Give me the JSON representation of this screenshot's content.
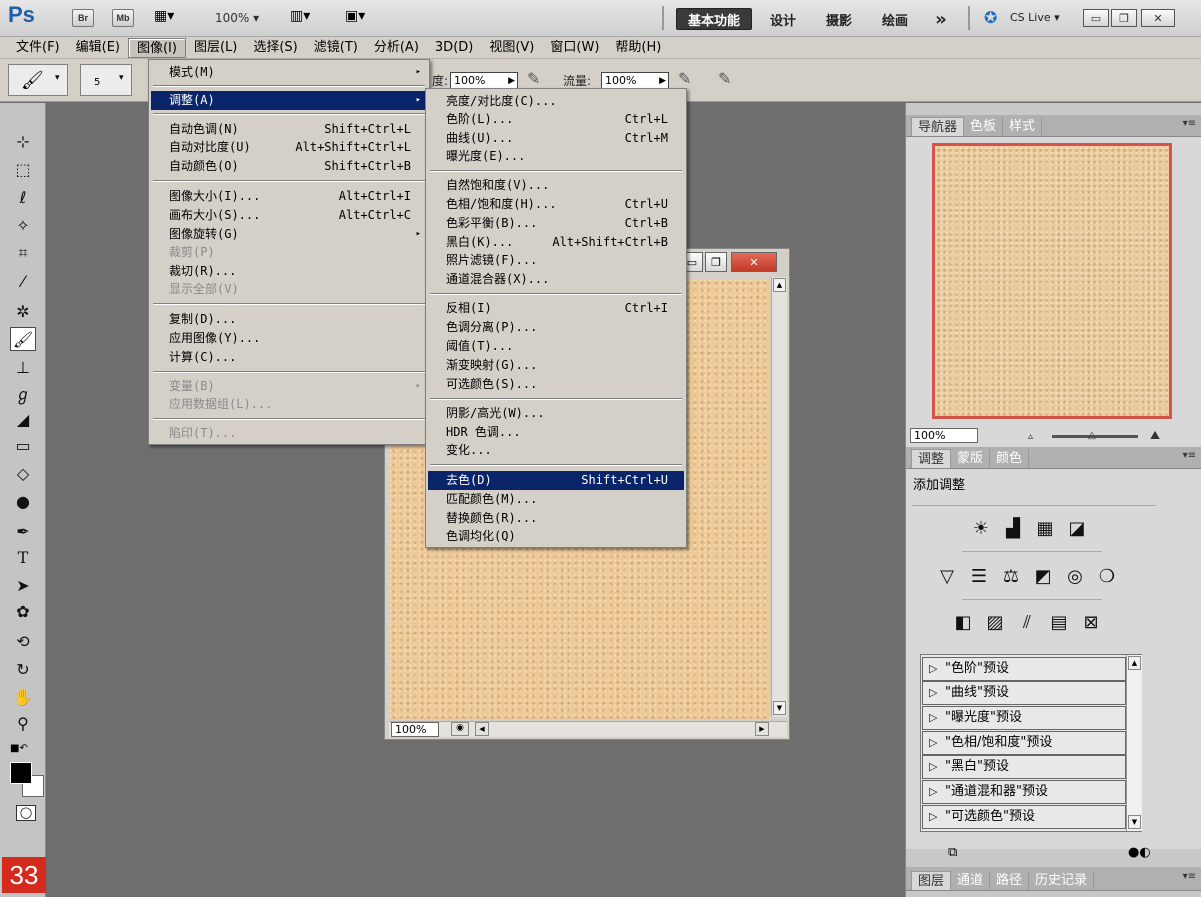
{
  "appbar": {
    "logo": "Ps",
    "br": "Br",
    "mb": "Mb",
    "zoom": "100%",
    "workspaces": [
      "基本功能",
      "设计",
      "摄影",
      "绘画"
    ],
    "more": "»",
    "cslive": "CS Live"
  },
  "menubar": [
    "文件(F)",
    "编辑(E)",
    "图像(I)",
    "图层(L)",
    "选择(S)",
    "滤镜(T)",
    "分析(A)",
    "3D(D)",
    "视图(V)",
    "窗口(W)",
    "帮助(H)"
  ],
  "options": {
    "brush_size": "5",
    "opacity_label": "度:",
    "opacity": "100%",
    "flow_label": "流量:",
    "flow": "100%"
  },
  "image_menu": {
    "items": [
      {
        "label": "模式(M)",
        "arrow": "▸"
      },
      {
        "label": "调整(A)",
        "arrow": "▸"
      },
      {
        "label": "自动色调(N)",
        "shortcut": "Shift+Ctrl+L"
      },
      {
        "label": "自动对比度(U)",
        "shortcut": "Alt+Shift+Ctrl+L"
      },
      {
        "label": "自动颜色(O)",
        "shortcut": "Shift+Ctrl+B"
      },
      {
        "label": "图像大小(I)...",
        "shortcut": "Alt+Ctrl+I"
      },
      {
        "label": "画布大小(S)...",
        "shortcut": "Alt+Ctrl+C"
      },
      {
        "label": "图像旋转(G)",
        "arrow": "▸"
      },
      {
        "label": "裁剪(P)"
      },
      {
        "label": "裁切(R)..."
      },
      {
        "label": "显示全部(V)"
      },
      {
        "label": "复制(D)..."
      },
      {
        "label": "应用图像(Y)..."
      },
      {
        "label": "计算(C)..."
      },
      {
        "label": "变量(B)",
        "arrow": "▸"
      },
      {
        "label": "应用数据组(L)..."
      },
      {
        "label": "陷印(T)..."
      }
    ]
  },
  "adjust_menu": {
    "items": [
      {
        "label": "亮度/对比度(C)..."
      },
      {
        "label": "色阶(L)...",
        "shortcut": "Ctrl+L"
      },
      {
        "label": "曲线(U)...",
        "shortcut": "Ctrl+M"
      },
      {
        "label": "曝光度(E)..."
      },
      {
        "label": "自然饱和度(V)..."
      },
      {
        "label": "色相/饱和度(H)...",
        "shortcut": "Ctrl+U"
      },
      {
        "label": "色彩平衡(B)...",
        "shortcut": "Ctrl+B"
      },
      {
        "label": "黑白(K)...",
        "shortcut": "Alt+Shift+Ctrl+B"
      },
      {
        "label": "照片滤镜(F)..."
      },
      {
        "label": "通道混合器(X)..."
      },
      {
        "label": "反相(I)",
        "shortcut": "Ctrl+I"
      },
      {
        "label": "色调分离(P)..."
      },
      {
        "label": "阈值(T)..."
      },
      {
        "label": "渐变映射(G)..."
      },
      {
        "label": "可选颜色(S)..."
      },
      {
        "label": "阴影/高光(W)..."
      },
      {
        "label": "HDR 色调..."
      },
      {
        "label": "变化..."
      },
      {
        "label": "去色(D)",
        "shortcut": "Shift+Ctrl+U"
      },
      {
        "label": "匹配颜色(M)..."
      },
      {
        "label": "替换颜色(R)..."
      },
      {
        "label": "色调均化(Q)"
      }
    ]
  },
  "document": {
    "zoom": "100%"
  },
  "navigator": {
    "tabs": [
      "导航器",
      "色板",
      "样式"
    ],
    "zoom": "100%"
  },
  "adjustments": {
    "tabs": [
      "调整",
      "蒙版",
      "颜色"
    ],
    "title": "添加调整",
    "presets": [
      "\"色阶\"预设",
      "\"曲线\"预设",
      "\"曝光度\"预设",
      "\"色相/饱和度\"预设",
      "\"黑白\"预设",
      "\"通道混和器\"预设",
      "\"可选颜色\"预设"
    ]
  },
  "layers": {
    "tabs": [
      "图层",
      "通道",
      "路径",
      "历史记录"
    ]
  },
  "badge": "33"
}
